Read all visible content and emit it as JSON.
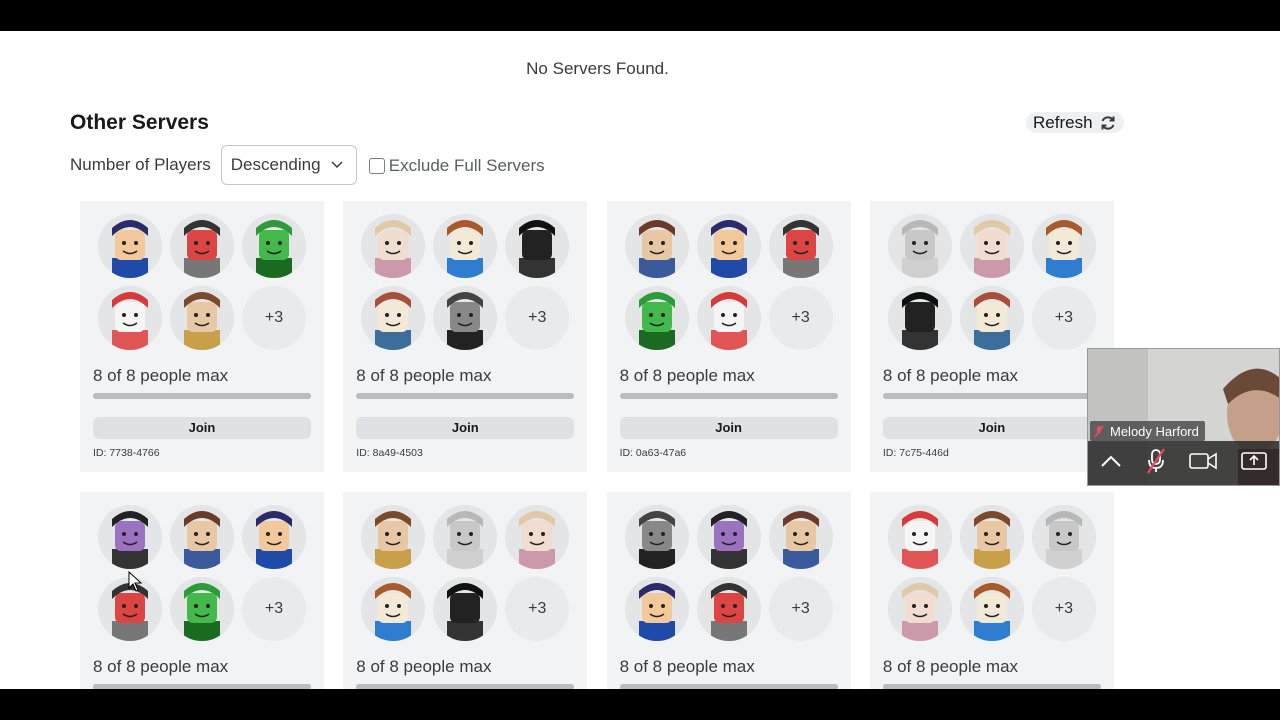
{
  "page": {
    "no_servers": "No Servers Found.",
    "section_title": "Other Servers",
    "refresh_label": "Refresh",
    "sort_label": "Number of Players",
    "sort_value": "Descending",
    "exclude_label": "Exclude Full Servers",
    "exclude_checked": false
  },
  "servers": [
    {
      "capacity": "8 of 8 people max",
      "join": "Join",
      "id": "ID: 7738-4766",
      "more": "+3",
      "fill": 1.0
    },
    {
      "capacity": "8 of 8 people max",
      "join": "Join",
      "id": "ID: 8a49-4503",
      "more": "+3",
      "fill": 1.0
    },
    {
      "capacity": "8 of 8 people max",
      "join": "Join",
      "id": "ID: 0a63-47a6",
      "more": "+3",
      "fill": 1.0
    },
    {
      "capacity": "8 of 8 people max",
      "join": "Join",
      "id": "ID: 7c75-446d",
      "more": "+3",
      "fill": 1.0
    },
    {
      "capacity": "8 of 8 people max",
      "more": "+3",
      "fill": 1.0
    },
    {
      "capacity": "8 of 8 people max",
      "more": "+3",
      "fill": 1.0
    },
    {
      "capacity": "8 of 8 people max",
      "more": "+3",
      "fill": 1.0
    },
    {
      "capacity": "8 of 8 people max",
      "more": "+3",
      "fill": 1.0
    }
  ],
  "video_call": {
    "participant_name": "Melody Harford",
    "icons": [
      "chevron-up-icon",
      "mic-muted-icon",
      "camera-icon",
      "share-screen-icon"
    ]
  },
  "colors": {
    "card_bg": "#f2f3f4",
    "avatar_bg": "#e3e5e7",
    "bar": "#c6c9cd",
    "join_bg": "#dfe1e4"
  }
}
